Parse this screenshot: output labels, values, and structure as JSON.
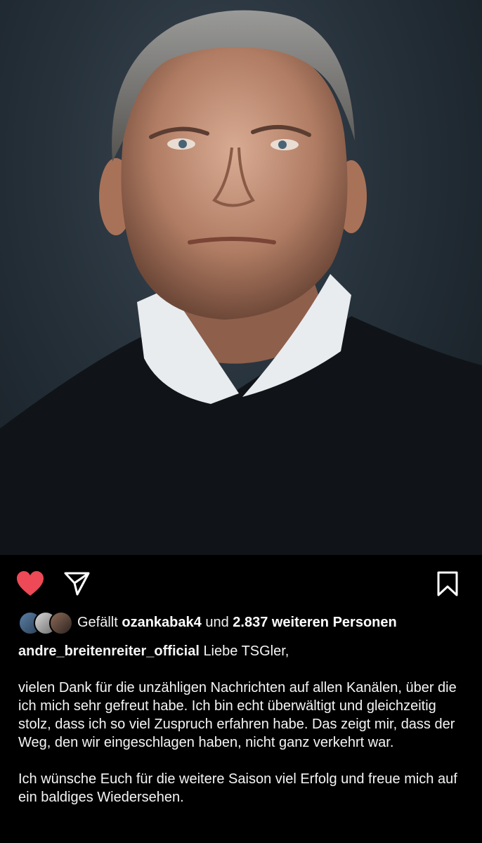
{
  "post": {
    "image_alt_icon": "portrait-photo"
  },
  "actions": {
    "like_icon": "heart-icon",
    "share_icon": "paper-plane-icon",
    "save_icon": "bookmark-icon",
    "like_color": "#ed4956"
  },
  "likes": {
    "prefix": "Gefällt",
    "user": "ozankabak4",
    "middle": "und",
    "count_text": "2.837 weiteren Personen"
  },
  "caption": {
    "username": "andre_breitenreiter_official",
    "first_line": "Liebe TSGler,",
    "paragraph1": "vielen Dank für die unzähligen Nachrichten auf allen Kanälen, über die ich mich sehr gefreut habe. Ich bin echt überwältigt und gleichzeitig stolz, dass ich so viel Zuspruch erfahren habe. Das zeigt mir, dass der Weg, den wir eingeschlagen haben, nicht ganz verkehrt war.",
    "paragraph2": "Ich wünsche Euch für die weitere Saison viel Erfolg und freue mich auf ein baldiges Wiedersehen."
  }
}
